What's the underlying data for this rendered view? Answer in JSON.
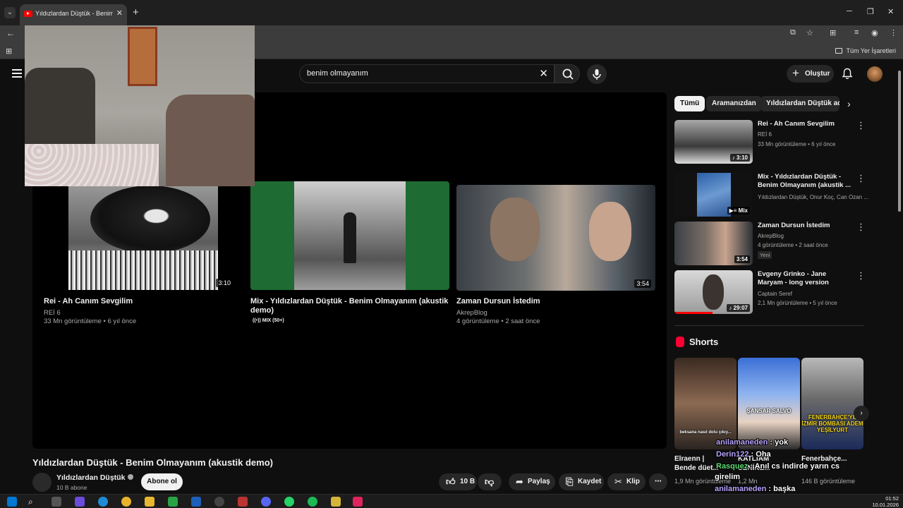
{
  "browser": {
    "tab_title": "Yıldızlardan Düştük - Benim Ol...",
    "tab_close": "✕",
    "new_tab": "+",
    "window_controls": [
      "─",
      "❐",
      "✕"
    ],
    "bookmarks_all": "Tüm Yer İşaretleri"
  },
  "masthead": {
    "search_value": "benim olmayanım",
    "create_label": "Oluştur"
  },
  "player": {
    "endcards": [
      {
        "title": "Rei - Ah Canım Sevgilim",
        "channel": "REİ 6",
        "meta": "33 Mn görüntüleme • 6 yıl önce",
        "duration": "3:10"
      },
      {
        "title": "Mix - Yıldızlardan Düştük - Benim Olmayanım (akustik demo)",
        "mix_tag": "MIX (50+)"
      },
      {
        "title": "Zaman Dursun İstedim",
        "channel": "AkrepBlog",
        "meta": "4 görüntüleme • 2 saat önce",
        "duration": "3:54"
      }
    ]
  },
  "video": {
    "title": "Yıldızlardan Düştük - Benim Olmayanım (akustik demo)",
    "channel": "Yıldızlardan Düştük",
    "subscribers": "10 B abone",
    "subscribe_label": "Abone ol",
    "like_count": "10 B",
    "share_label": "Paylaş",
    "save_label": "Kaydet",
    "clip_label": "Klip",
    "more": "⋯"
  },
  "chips": [
    "Tümü",
    "Aramanızdan",
    "Yıldızlardan Düştük adlı"
  ],
  "recommendations": [
    {
      "title": "Rei - Ah Canım Sevgilim",
      "channel": "REİ 6",
      "meta": "33 Mn görüntüleme • 6 yıl önce",
      "duration": "3:10"
    },
    {
      "title": "Mix - Yıldızlardan Düştük - Benim Olmayanım (akustik ...",
      "channel": "Yıldızlardan Düştük, Onur Koç, Can Ozan ...",
      "meta": "",
      "duration": "Mix"
    },
    {
      "title": "Zaman Dursun İstedim",
      "channel": "AkrepBlog",
      "meta": "4 görüntüleme • 2 saat önce",
      "badge": "Yeni",
      "duration": "3:54"
    },
    {
      "title": "Evgeny Grinko - Jane Maryam - long version",
      "channel": "Captain Seref",
      "meta": "2,1 Mn görüntüleme • 5 yıl önce",
      "duration": "29:07"
    }
  ],
  "shorts": {
    "heading": "Shorts",
    "items": [
      {
        "caption": "beksana nasıl dolu çıkıy...",
        "title": "Elraenn | Bende düet...",
        "views": "1,9 Mn görüntüleme"
      },
      {
        "caption": "ŞANSAR SALVO",
        "title": "KATLİAM SENİNE...",
        "views": "1,2 Mn"
      },
      {
        "caption": "FENERBAHÇE'YE İZMİR BOMBASI ADEM YEŞİLYURT",
        "title": "Fenerbahçe...",
        "views": "146 B görüntüleme"
      }
    ]
  },
  "chat_overlay": [
    {
      "user": "anilamaneden",
      "text": " : yok",
      "color": "purple"
    },
    {
      "user": "Derin122",
      "text": " : Oha",
      "color": "purple"
    },
    {
      "user": "Rasquez",
      "text": " : Anıl cs indirde yarın cs",
      "color": "green"
    },
    {
      "user": "",
      "text": "girelim",
      "color": ""
    },
    {
      "user": "anilamaneden",
      "text": " : başka",
      "color": "purple"
    }
  ],
  "taskbar": {
    "time": "01:52",
    "date": "10.01.2026"
  },
  "colors": {
    "background": "#0f0f0f",
    "youtube_red": "#ff0000",
    "chip_active": "#f1f1f1",
    "secondary_text": "#aaaaaa"
  },
  "icons": [
    "back-icon",
    "apps-icon",
    "menu-icon",
    "search-icon",
    "mic-icon",
    "bell-icon",
    "like-icon",
    "dislike-icon",
    "share-icon",
    "save-icon",
    "clip-icon",
    "verified-icon",
    "shorts-icon"
  ]
}
